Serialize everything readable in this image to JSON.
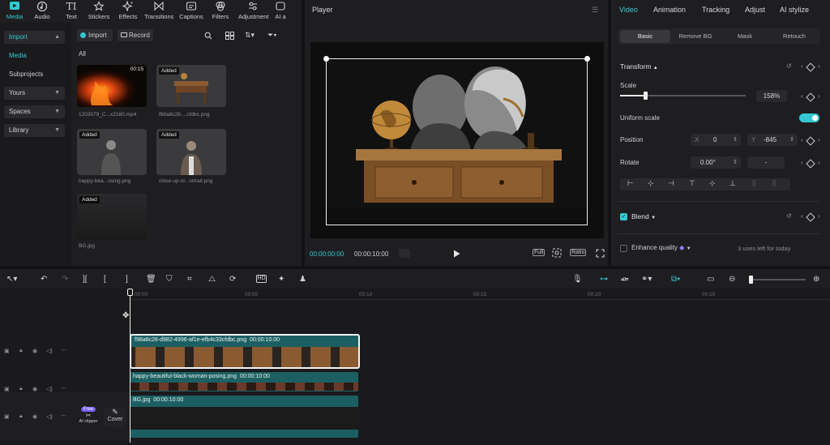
{
  "toolbar": {
    "items": [
      {
        "label": "Media",
        "icon": "media-icon"
      },
      {
        "label": "Audio",
        "icon": "audio-icon"
      },
      {
        "label": "Text",
        "icon": "text-icon"
      },
      {
        "label": "Stickers",
        "icon": "sticker-icon"
      },
      {
        "label": "Effects",
        "icon": "effects-icon"
      },
      {
        "label": "Transitions",
        "icon": "transitions-icon"
      },
      {
        "label": "Captions",
        "icon": "captions-icon"
      },
      {
        "label": "Filters",
        "icon": "filters-icon"
      },
      {
        "label": "Adjustment",
        "icon": "adjustment-icon"
      },
      {
        "label": "AI a",
        "icon": "ai-icon"
      }
    ],
    "accent": "#35c8d2"
  },
  "sidebar": {
    "import": "Import",
    "media": "Media",
    "subprojects": "Subprojects",
    "yours": "Yours",
    "spaces": "Spaces",
    "library": "Library"
  },
  "media_panel": {
    "import_button": "Import",
    "record_button": "Record",
    "filter_all": "All",
    "items": [
      {
        "caption": "1203079_C...x2160.mp4",
        "duration": "00:15",
        "badge": ""
      },
      {
        "caption": "f98a8c28-...cfdbc.png",
        "duration": "",
        "badge": "Added"
      },
      {
        "caption": "happy-bea...osing.png",
        "duration": "",
        "badge": "Added"
      },
      {
        "caption": "close-up-ol...ortrait.png",
        "duration": "",
        "badge": "Added"
      },
      {
        "caption": "BG.jpg",
        "duration": "",
        "badge": "Added"
      }
    ]
  },
  "player": {
    "title": "Player",
    "current_time": "00:00:00:00",
    "total_time": "00:00:10:00",
    "full_label": "Full",
    "ratio_label": "Ratio"
  },
  "inspector": {
    "tabs": [
      "Video",
      "Animation",
      "Tracking",
      "Adjust",
      "AI stylize"
    ],
    "subtabs": [
      "Basic",
      "Remove BG",
      "Mask",
      "Retouch"
    ],
    "transform": "Transform",
    "scale_label": "Scale",
    "scale_value": "158%",
    "scale_fraction": 0.2,
    "uniform_scale": "Uniform scale",
    "position_label": "Position",
    "x_label": "X",
    "x_value": "0",
    "y_label": "Y",
    "y_value": "-845",
    "rotate_label": "Rotate",
    "rotate_value": "0.00°",
    "rotate_dash": "-",
    "blend": "Blend",
    "enhance_quality": "Enhance quality",
    "uses_left": "3 uses left for today"
  },
  "timeline": {
    "ruler": [
      "00:00",
      "00:05",
      "00:10",
      "00:15",
      "00:20",
      "00:25"
    ],
    "clips": [
      {
        "name": "f98a8c28-d982-4996-af1e-efb4c33cfdbc.png",
        "duration": "00:00:10:00"
      },
      {
        "name": "happy-beautiful-black-woman-posing.png",
        "duration": "00:00:10:00"
      },
      {
        "name": "BG.jpg",
        "duration": "00:00:10:00"
      }
    ],
    "free_badge": "Free",
    "ai_clipper": "AI clipper",
    "cover": "Cover"
  }
}
